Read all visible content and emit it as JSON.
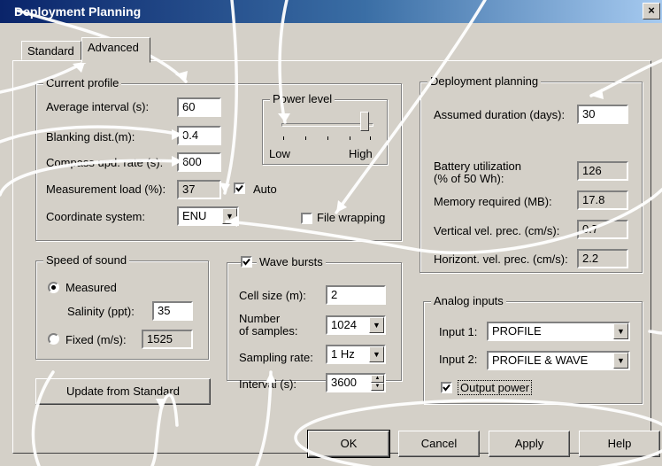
{
  "window": {
    "title": "Deployment Planning",
    "close_glyph": "×"
  },
  "tabs": [
    {
      "label": "Standard",
      "active": false
    },
    {
      "label": "Advanced",
      "active": true
    }
  ],
  "current_profile": {
    "title": "Current profile",
    "average_interval": {
      "label": "Average interval (s):",
      "value": "60"
    },
    "blanking_dist": {
      "label": "Blanking dist.(m):",
      "value": "0.4"
    },
    "compass_upd_rate": {
      "label": "Compass upd. rate (s):",
      "value": "600"
    },
    "measurement_load": {
      "label": "Measurement load (%):",
      "value": "37"
    },
    "auto": {
      "label": "Auto",
      "checked": true
    },
    "coordinate_system": {
      "label": "Coordinate system:",
      "value": "ENU"
    },
    "file_wrapping": {
      "label": "File wrapping",
      "checked": false
    },
    "power_level": {
      "title": "Power level",
      "low_label": "Low",
      "high_label": "High",
      "level": 0.95
    }
  },
  "speed_of_sound": {
    "title": "Speed of sound",
    "measured": {
      "label": "Measured",
      "selected": true
    },
    "salinity": {
      "label": "Salinity (ppt):",
      "value": "35"
    },
    "fixed": {
      "label": "Fixed (m/s):",
      "value": "1525",
      "selected": false
    }
  },
  "wave_bursts": {
    "label": "Wave bursts",
    "checked": true,
    "cell_size": {
      "label": "Cell size (m):",
      "value": "2"
    },
    "number_of_samples": {
      "label_line1": "Number",
      "label_line2": "of samples:",
      "value": "1024"
    },
    "sampling_rate": {
      "label": "Sampling rate:",
      "value": "1 Hz"
    },
    "interval": {
      "label": "Interval (s):",
      "value": "3600"
    }
  },
  "update_button": "Update from Standard",
  "deployment_planning": {
    "title": "Deployment planning",
    "assumed_duration": {
      "label": "Assumed duration (days):",
      "value": "30"
    },
    "battery_utilization": {
      "label_line1": "Battery utilization",
      "label_line2": "(% of 50 Wh):",
      "value": "126"
    },
    "memory_required": {
      "label": "Memory required (MB):",
      "value": "17.8"
    },
    "vertical_vel_prec": {
      "label": "Vertical vel. prec. (cm/s):",
      "value": "0.7"
    },
    "horizont_vel_prec": {
      "label": "Horizont. vel. prec. (cm/s):",
      "value": "2.2"
    }
  },
  "analog_inputs": {
    "title": "Analog inputs",
    "input1": {
      "label": "Input 1:",
      "value": "PROFILE"
    },
    "input2": {
      "label": "Input 2:",
      "value": "PROFILE & WAVE"
    },
    "output_power": {
      "label": "Output power",
      "checked": true
    }
  },
  "buttons": {
    "ok": "OK",
    "cancel": "Cancel",
    "apply": "Apply",
    "help": "Help"
  },
  "icons": {
    "check": "check-mark-icon",
    "dropdown": "chevron-down-icon",
    "spin": "spin-arrows-icon",
    "close": "close-icon"
  },
  "colors": {
    "face": "#d4d0c8",
    "title_start": "#0a246a",
    "title_end": "#a6caf0",
    "overlay_curves": "#ffffff"
  }
}
